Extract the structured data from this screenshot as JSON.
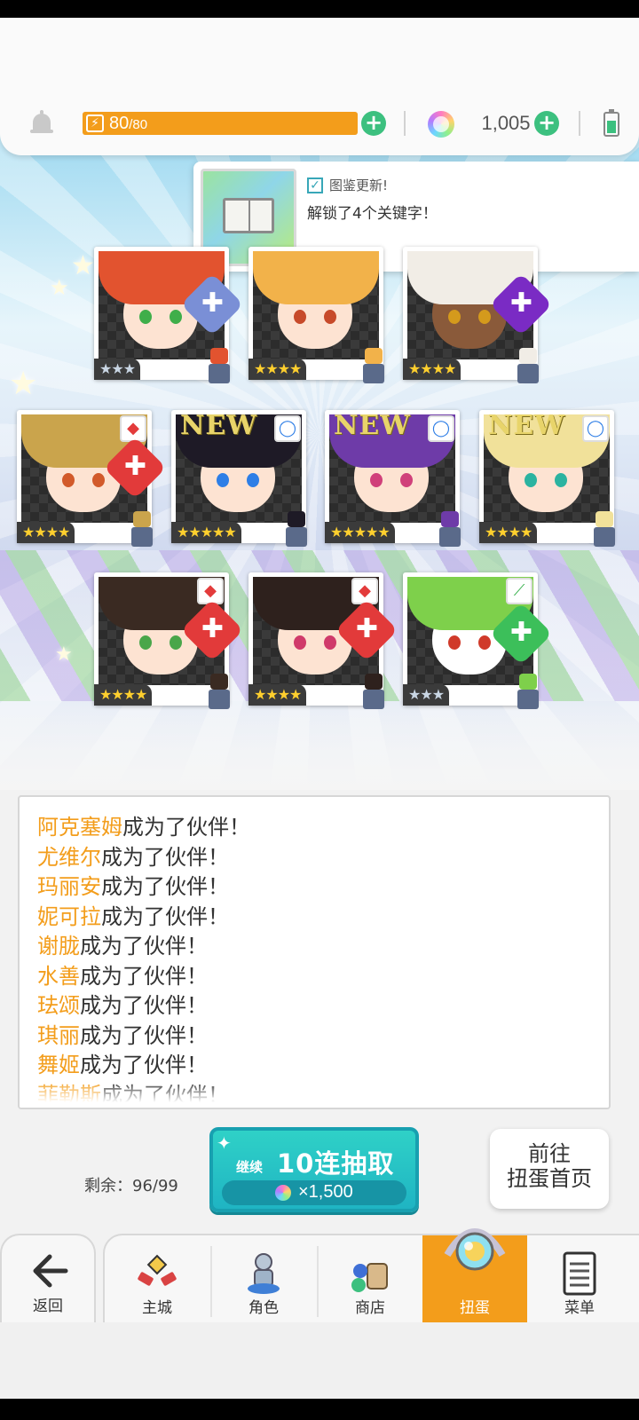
{
  "status": {
    "stamina_current": "80",
    "stamina_max": "/80",
    "stamina_fill_fraction": 1.0,
    "gem_count": "1,005"
  },
  "notice": {
    "title": "图鉴更新!",
    "body": "解锁了4个关键字！"
  },
  "cards": [
    {
      "rarity": "★★★",
      "is_new": false,
      "attribute": "shield"
    },
    {
      "rarity": "★★★★",
      "is_new": false,
      "attribute": "sword"
    },
    {
      "rarity": "★★★★",
      "is_new": false,
      "attribute": "dark"
    },
    {
      "rarity": "★★★★",
      "is_new": false,
      "attribute": "fire"
    },
    {
      "rarity": "★★★★★",
      "is_new": true,
      "new_label": "NEW",
      "attribute": "water"
    },
    {
      "rarity": "★★★★★",
      "is_new": true,
      "new_label": "NEW",
      "attribute": "water"
    },
    {
      "rarity": "★★★★",
      "is_new": true,
      "new_label": "NEW",
      "attribute": "water"
    },
    {
      "rarity": "★★★★",
      "is_new": false,
      "attribute": "fire"
    },
    {
      "rarity": "★★★★",
      "is_new": false,
      "attribute": "fire"
    },
    {
      "rarity": "★★★",
      "is_new": false,
      "attribute": "wind"
    }
  ],
  "log": {
    "suffix": "成为了伙伴！",
    "names": [
      "阿克塞姆",
      "尤维尔",
      "玛丽安",
      "妮可拉",
      "谢胧",
      "水善",
      "珐颂",
      "琪丽",
      "舞姬",
      "菲勒斯"
    ]
  },
  "gacha": {
    "remaining": "剩余：96/99",
    "continue_label": "继续",
    "pull_label": "10连抽取",
    "cost": "×1,500",
    "goto_line1": "前往",
    "goto_line2": "扭蛋首页"
  },
  "nav": {
    "back": "返回",
    "items": [
      "主城",
      "角色",
      "商店",
      "扭蛋",
      "菜单"
    ],
    "active": "扭蛋"
  },
  "colors": {
    "accent_orange": "#f39d1b",
    "plus_green": "#3cc07f",
    "pull_teal": "#1fb4c3"
  }
}
